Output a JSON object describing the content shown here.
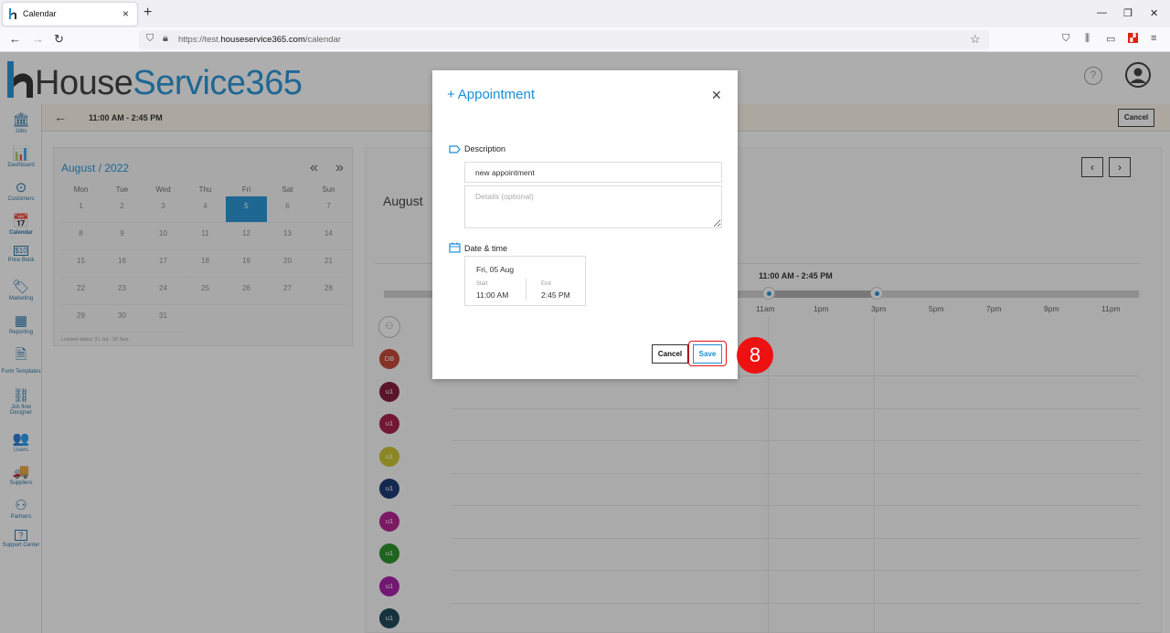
{
  "browser": {
    "tab_title": "Calendar",
    "tab_close": "×",
    "new_tab": "+",
    "url_prefix": "https://test.",
    "url_domain": "houseservice365.com",
    "url_path": "/calendar",
    "win_min": "—",
    "win_restore": "❐",
    "win_close": "✕"
  },
  "app": {
    "logo_house": "House",
    "logo_service": "Service365",
    "brand_color": "#1b8fd6",
    "help_glyph": "?"
  },
  "sidebar": {
    "items": [
      {
        "label": "Jobs",
        "icon": "jobs-icon",
        "glyph": "🏛"
      },
      {
        "label": "Dashboard",
        "icon": "dashboard-icon",
        "glyph": "📊"
      },
      {
        "label": "Customers",
        "icon": "customers-icon",
        "glyph": "⊙"
      },
      {
        "label": "Calendar",
        "icon": "calendar-icon",
        "glyph": "📅"
      },
      {
        "label": "Price Book",
        "icon": "price-book-icon",
        "glyph": "$10"
      },
      {
        "label": "Marketing",
        "icon": "marketing-icon",
        "glyph": "🏷"
      },
      {
        "label": "Reporting",
        "icon": "reporting-icon",
        "glyph": "▦"
      },
      {
        "label": "Form Templates",
        "icon": "form-templates-icon",
        "glyph": "🗎"
      },
      {
        "label": "Job flow Designer",
        "icon": "job-flow-designer-icon",
        "glyph": "⛓"
      },
      {
        "label": "Users",
        "icon": "users-icon",
        "glyph": "👥"
      },
      {
        "label": "Suppliers",
        "icon": "suppliers-icon",
        "glyph": "🚚"
      },
      {
        "label": "Partners",
        "icon": "partners-icon",
        "glyph": "⚇"
      },
      {
        "label": "Support Center",
        "icon": "support-center-icon",
        "glyph": "?"
      }
    ]
  },
  "subbar": {
    "range": "11:00 AM - 2:45 PM",
    "cancel": "Cancel"
  },
  "minical": {
    "title": "August / 2022",
    "prev": "«",
    "next": "»",
    "dow": [
      "Mon",
      "Tue",
      "Wed",
      "Thu",
      "Fri",
      "Sat",
      "Sun"
    ],
    "weeks": [
      [
        "1",
        "2",
        "3",
        "4",
        "5",
        "6",
        "7"
      ],
      [
        "8",
        "9",
        "10",
        "11",
        "12",
        "13",
        "14"
      ],
      [
        "15",
        "16",
        "17",
        "18",
        "19",
        "20",
        "21"
      ],
      [
        "22",
        "23",
        "24",
        "25",
        "26",
        "27",
        "28"
      ],
      [
        "29",
        "30",
        "31",
        "",
        "",
        "",
        ""
      ]
    ],
    "selected": "5",
    "loaded": "Loaded dates: 31 Jul - 30 Sep"
  },
  "main": {
    "month": "August",
    "prev": "‹",
    "next": "›",
    "range_label": "11:00 AM - 2:45 PM",
    "hours": [
      "11am",
      "1pm",
      "3pm",
      "5pm",
      "7pm",
      "9pm",
      "11pm"
    ],
    "avatars": [
      {
        "initials": "DB",
        "color": "#c0392b"
      },
      {
        "initials": "u1",
        "color": "#7a0a2a"
      },
      {
        "initials": "u1",
        "color": "#a0103a"
      },
      {
        "initials": "u1",
        "color": "#c9c020"
      },
      {
        "initials": "u1",
        "color": "#0b2a6a"
      },
      {
        "initials": "u1",
        "color": "#b0108a"
      },
      {
        "initials": "u1",
        "color": "#1a8a1a"
      },
      {
        "initials": "u1",
        "color": "#a010a0"
      },
      {
        "initials": "u1",
        "color": "#0a3a4a"
      }
    ]
  },
  "modal": {
    "title": "Appointment",
    "plus": "+",
    "close": "✕",
    "description_label": "Description",
    "description_value": "new appointment",
    "details_placeholder": "Details (optional)",
    "datetime_label": "Date & time",
    "date": "Fri, 05 Aug",
    "start_label": "Start",
    "start_value": "11:00 AM",
    "end_label": "End",
    "end_value": "2:45 PM",
    "cancel": "Cancel",
    "save": "Save"
  },
  "annotation": {
    "step": "8"
  }
}
